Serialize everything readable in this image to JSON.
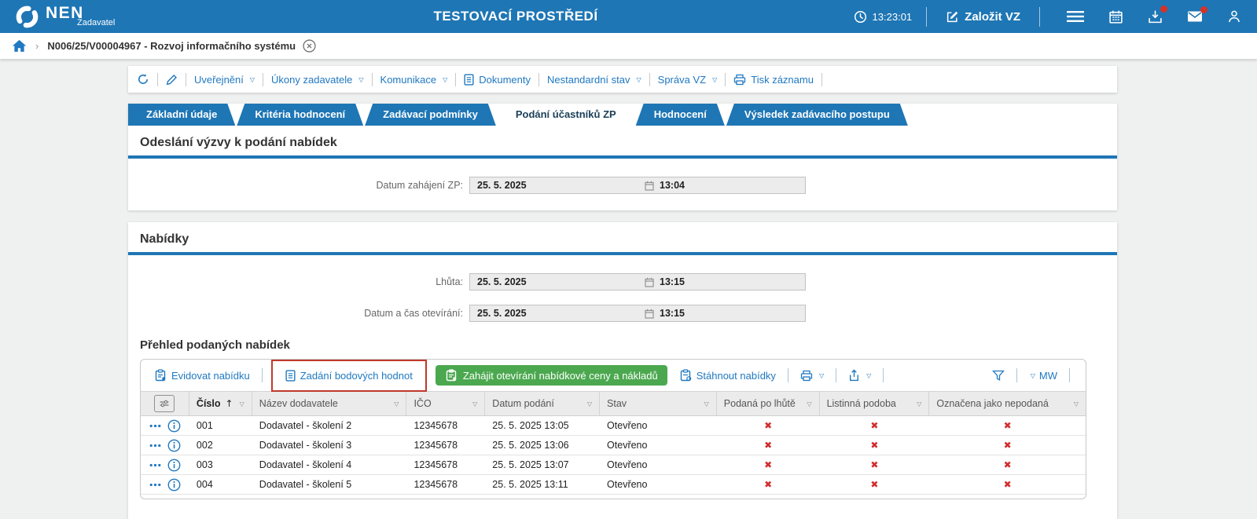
{
  "app": {
    "brand": "NEN",
    "brand_subtitle": "Zadavatel",
    "environment_title": "TESTOVACÍ PROSTŘEDÍ",
    "clock": "13:23:01",
    "create_button": "Založit VZ"
  },
  "breadcrumb": {
    "record": "N006/25/V00004967 - Rozvoj informačního systému"
  },
  "record_toolbar": {
    "items": [
      {
        "label": "Uveřejnění"
      },
      {
        "label": "Úkony zadavatele"
      },
      {
        "label": "Komunikace"
      },
      {
        "label": "Dokumenty"
      },
      {
        "label": "Nestandardní stav"
      },
      {
        "label": "Správa VZ"
      },
      {
        "label": "Tisk záznamu"
      }
    ]
  },
  "tabs": [
    {
      "label": "Základní údaje",
      "active": false
    },
    {
      "label": "Kritéria hodnocení",
      "active": false
    },
    {
      "label": "Zadávací podmínky",
      "active": false
    },
    {
      "label": "Podání účastníků ZP",
      "active": true
    },
    {
      "label": "Hodnocení",
      "active": false
    },
    {
      "label": "Výsledek zadávacího postupu",
      "active": false
    }
  ],
  "section_invitation": {
    "title": "Odeslání výzvy k podání nabídek",
    "field": {
      "label": "Datum zahájení ZP:",
      "date": "25. 5. 2025",
      "time": "13:04"
    }
  },
  "section_offers": {
    "title": "Nabídky",
    "deadline_field": {
      "label": "Lhůta:",
      "date": "25. 5. 2025",
      "time": "13:15"
    },
    "opening_field": {
      "label": "Datum a čas otevírání:",
      "date": "25. 5. 2025",
      "time": "13:15"
    },
    "overview_title": "Přehled podaných nabídek",
    "toolbar": {
      "register": "Evidovat nabídku",
      "scores": "Zadání bodových hodnot",
      "open_prices": "Zahájit otevírání nabídkové ceny a nákladů",
      "download": "Stáhnout nabídky",
      "mw": "MW"
    },
    "table": {
      "columns": [
        "Číslo",
        "Název dodavatele",
        "IČO",
        "Datum podání",
        "Stav",
        "Podaná po lhůtě",
        "Listinná podoba",
        "Označena jako nepodaná"
      ],
      "rows": [
        {
          "cislo": "001",
          "nazev": "Dodavatel - školení 2",
          "ico": "12345678",
          "datum": "25. 5. 2025 13:05",
          "stav": "Otevřeno",
          "po_lhute": "✖",
          "listinna": "✖",
          "nepodana": "✖"
        },
        {
          "cislo": "002",
          "nazev": "Dodavatel - školení 3",
          "ico": "12345678",
          "datum": "25. 5. 2025 13:06",
          "stav": "Otevřeno",
          "po_lhute": "✖",
          "listinna": "✖",
          "nepodana": "✖"
        },
        {
          "cislo": "003",
          "nazev": "Dodavatel - školení 4",
          "ico": "12345678",
          "datum": "25. 5. 2025 13:07",
          "stav": "Otevřeno",
          "po_lhute": "✖",
          "listinna": "✖",
          "nepodana": "✖"
        },
        {
          "cislo": "004",
          "nazev": "Dodavatel - školení 5",
          "ico": "12345678",
          "datum": "25. 5. 2025 13:11",
          "stav": "Otevřeno",
          "po_lhute": "✖",
          "listinna": "✖",
          "nepodana": "✖"
        }
      ]
    }
  },
  "icons": {
    "dropdown_arrow": "▽",
    "sort_asc": "↑",
    "breadcrumb_chevron": "›"
  },
  "colors": {
    "header_blue": "#1e76b5",
    "link_blue": "#1f78c1",
    "accent_green": "#4ba84f",
    "cross_red": "#d22d2d",
    "highlight_red": "#c0392b"
  }
}
